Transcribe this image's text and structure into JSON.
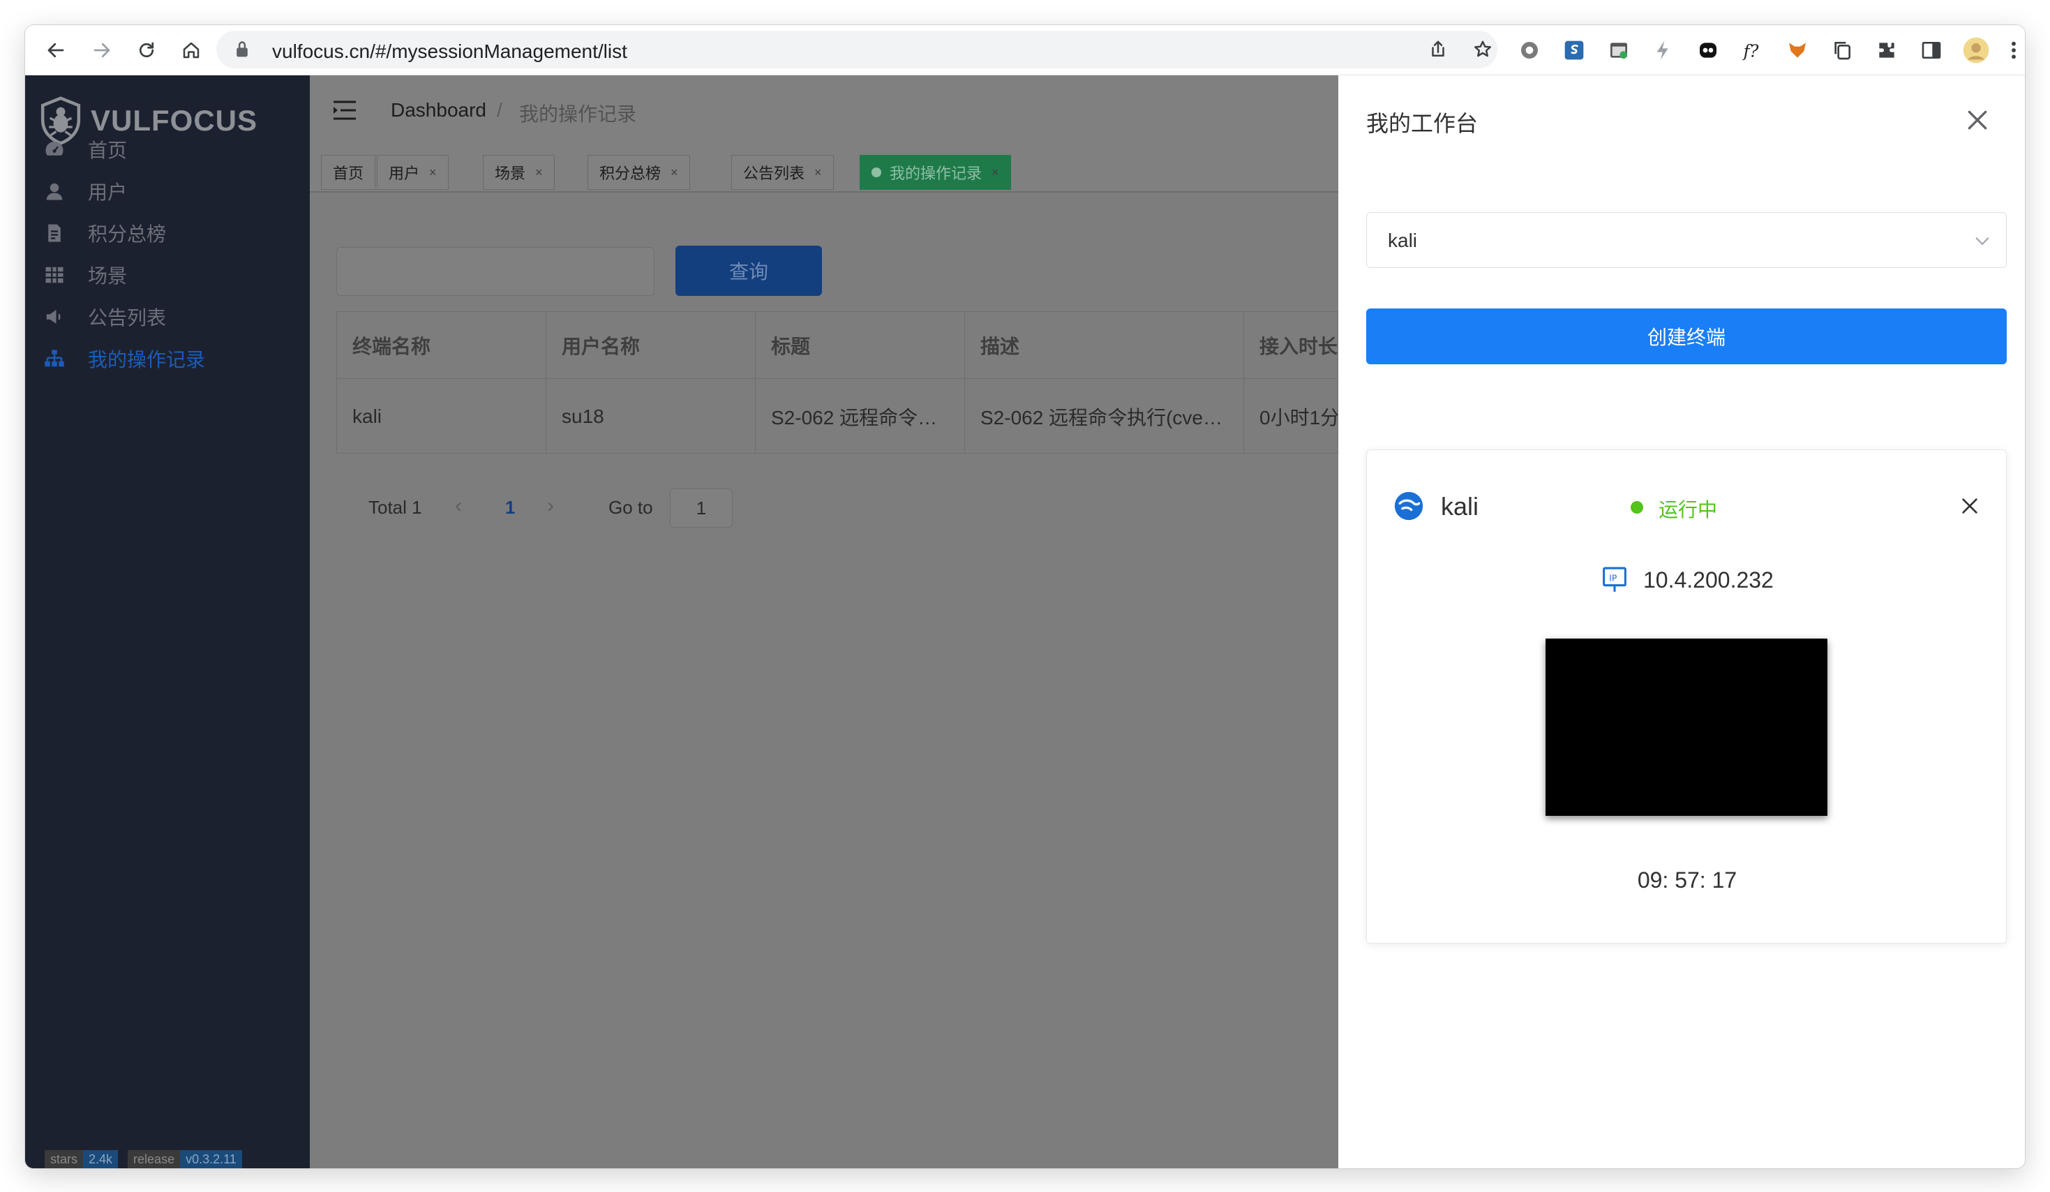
{
  "browser": {
    "url": "vulfocus.cn/#/mysessionManagement/list"
  },
  "sidebar": {
    "logo_text": "VULFOCUS",
    "items": [
      {
        "label": "首页",
        "icon": "dashboard-icon"
      },
      {
        "label": "用户",
        "icon": "user-icon"
      },
      {
        "label": "积分总榜",
        "icon": "document-icon"
      },
      {
        "label": "场景",
        "icon": "grid-icon"
      },
      {
        "label": "公告列表",
        "icon": "speaker-icon"
      },
      {
        "label": "我的操作记录",
        "icon": "tree-icon",
        "active": true
      }
    ],
    "badges": [
      {
        "key": "stars",
        "value": "2.4k"
      },
      {
        "key": "release",
        "value": "v0.3.2.11"
      }
    ]
  },
  "header": {
    "breadcrumb_root": "Dashboard",
    "breadcrumb_sep": "/",
    "breadcrumb_current": "我的操作记录"
  },
  "tags": [
    {
      "label": "首页",
      "closable": false
    },
    {
      "label": "用户",
      "closable": true
    },
    {
      "label": "场景",
      "closable": true
    },
    {
      "label": "积分总榜",
      "closable": true
    },
    {
      "label": "公告列表",
      "closable": true
    },
    {
      "label": "我的操作记录",
      "closable": true,
      "active": true
    }
  ],
  "tag_close_glyph": "×",
  "search": {
    "placeholder": "",
    "button_label": "查询"
  },
  "table": {
    "columns": [
      "终端名称",
      "用户名称",
      "标题",
      "描述",
      "接入时长"
    ],
    "rows": [
      [
        "kali",
        "su18",
        "S2-062 远程命令…",
        "S2-062 远程命令执行(cve…",
        "0小时1分"
      ]
    ]
  },
  "pagination": {
    "total_label": "Total 1",
    "prev": "‹",
    "current_page": "1",
    "next": "›",
    "goto_label": "Go to",
    "goto_value": "1"
  },
  "drawer": {
    "title": "我的工作台",
    "select_value": "kali",
    "create_button": "创建终端",
    "card": {
      "name": "kali",
      "status": "运行中",
      "ip": "10.4.200.232",
      "timer": "09: 57: 17"
    }
  },
  "colors": {
    "primary": "#1a7ef6",
    "running": "#52c41a",
    "sidebar_bg": "#1c2130",
    "tag_active": "#1f7a4a"
  }
}
